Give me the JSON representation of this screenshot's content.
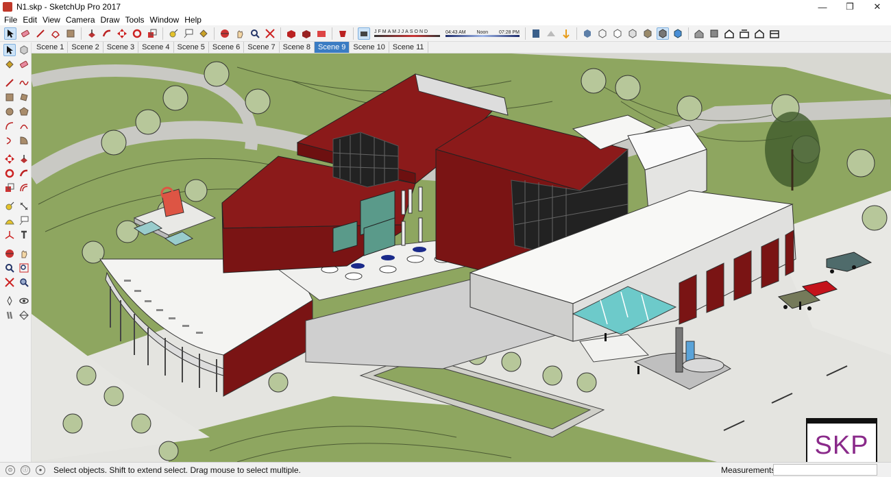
{
  "window": {
    "title": "N1.skp - SketchUp Pro 2017",
    "minimize": "—",
    "maximize": "❐",
    "close": "✕"
  },
  "menu": [
    "File",
    "Edit",
    "View",
    "Camera",
    "Draw",
    "Tools",
    "Window",
    "Help"
  ],
  "shadow_settings": {
    "months": [
      "J",
      "F",
      "M",
      "A",
      "M",
      "J",
      "J",
      "A",
      "S",
      "O",
      "N",
      "D"
    ],
    "time_start": "04:43 AM",
    "time_mid": "Noon",
    "time_end": "07:28 PM"
  },
  "scenes": {
    "tabs": [
      "Scene 1",
      "Scene 2",
      "Scene 3",
      "Scene 4",
      "Scene 5",
      "Scene 6",
      "Scene 7",
      "Scene 8",
      "Scene 9",
      "Scene 10",
      "Scene 11"
    ],
    "active": "Scene 9"
  },
  "status": {
    "message": "Select objects. Shift to extend select. Drag mouse to select multiple.",
    "measurements_label": "Measurements",
    "measurements_value": ""
  },
  "watermark": "SKP",
  "colors": {
    "roof_red": "#8b1a1a",
    "wall_red": "#7a1414",
    "grass": "#8ea660",
    "paving": "#e4e4e0",
    "active_tab": "#3a7cc3"
  }
}
